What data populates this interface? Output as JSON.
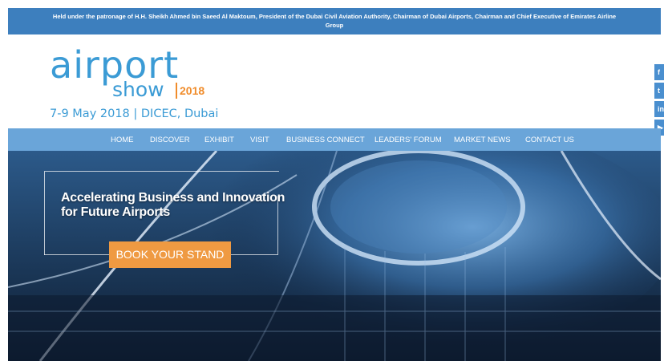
{
  "patronage": {
    "line1": "Held under the patronage of H.H. Sheikh Ahmed bin Saeed Al Maktoum, President of the Dubai Civil Aviation Authority, Chairman of Dubai Airports, Chairman and Chief Executive of Emirates Airline",
    "line2": "Group"
  },
  "logo": {
    "word1": "airport",
    "word2": "show",
    "year": "2018",
    "dates": "7-9 May 2018 | DICEC, Dubai"
  },
  "nav": {
    "items": [
      "HOME",
      "DISCOVER",
      "EXHIBIT",
      "VISIT",
      "BUSINESS CONNECT",
      "LEADERS' FORUM",
      "MARKET NEWS",
      "CONTACT US"
    ]
  },
  "hero": {
    "headline_line1": "Accelerating Business and Innovation",
    "headline_line2": "for Future Airports",
    "cta_label": "BOOK YOUR STAND"
  },
  "social": {
    "icons": [
      {
        "name": "facebook-icon",
        "glyph": "f"
      },
      {
        "name": "twitter-icon",
        "glyph": "t"
      },
      {
        "name": "linkedin-icon",
        "glyph": "in"
      },
      {
        "name": "youtube-icon",
        "glyph": "▶"
      }
    ]
  },
  "colors": {
    "patronage_bg": "#3d7fbe",
    "nav_bg": "#6aa5d9",
    "brand_blue": "#3b9bd5",
    "brand_orange": "#f08c2b",
    "cta_bg": "#ef9a42"
  }
}
